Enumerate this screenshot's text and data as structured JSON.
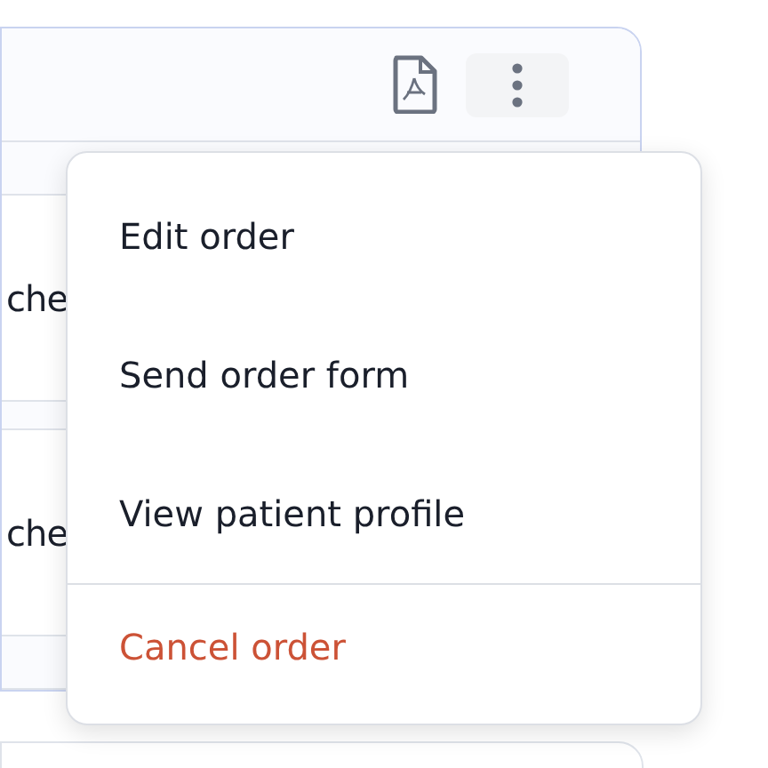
{
  "rows": [
    {
      "cell_1": "che"
    },
    {
      "cell_1": "che"
    }
  ],
  "menu": {
    "items": [
      {
        "label": "Edit order",
        "kind": "normal"
      },
      {
        "label": "Send order form",
        "kind": "normal"
      },
      {
        "label": "View patient profile",
        "kind": "normal"
      },
      {
        "label": "Cancel order",
        "kind": "danger"
      }
    ]
  }
}
